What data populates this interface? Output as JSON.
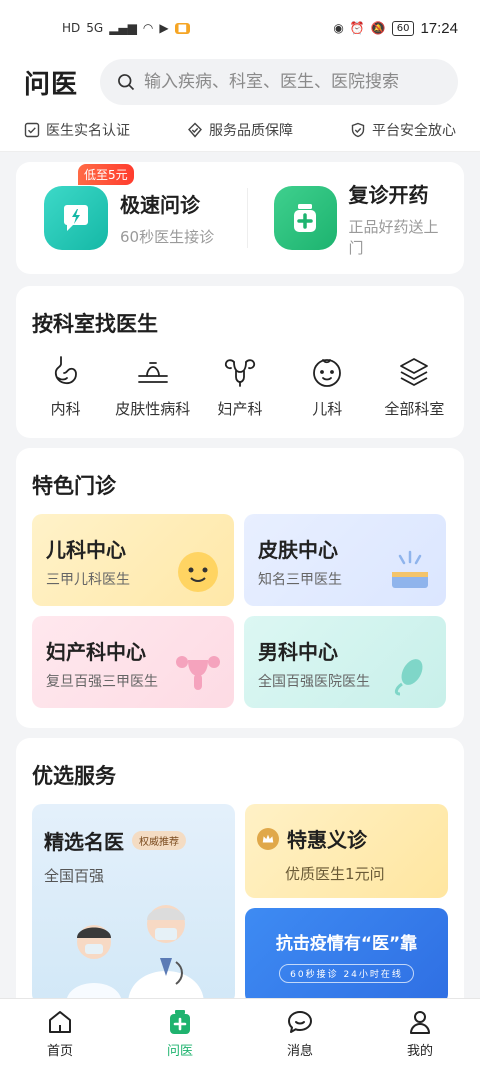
{
  "status_bar": {
    "hd": "HD",
    "network": "5G",
    "battery": "60",
    "time": "17:24"
  },
  "header": {
    "title": "问医",
    "search_placeholder": "输入疾病、科室、医生、医院搜索"
  },
  "assurances": [
    {
      "label": "医生实名认证",
      "icon": "check-square-icon"
    },
    {
      "label": "服务品质保障",
      "icon": "diamond-check-icon"
    },
    {
      "label": "平台安全放心",
      "icon": "shield-check-icon"
    }
  ],
  "quick": {
    "fast": {
      "title": "极速问诊",
      "subtitle": "60秒医生接诊",
      "badge": "低至5元",
      "icon": "chat-lightning-icon"
    },
    "revisit": {
      "title": "复诊开药",
      "subtitle": "正品好药送上门",
      "icon": "medicine-bottle-icon"
    }
  },
  "departments": {
    "title": "按科室找医生",
    "items": [
      {
        "label": "内科",
        "icon": "stomach-icon"
      },
      {
        "label": "皮肤性病科",
        "icon": "skin-icon"
      },
      {
        "label": "妇产科",
        "icon": "uterus-icon"
      },
      {
        "label": "儿科",
        "icon": "baby-face-icon"
      },
      {
        "label": "全部科室",
        "icon": "layers-icon"
      }
    ]
  },
  "special_clinics": {
    "title": "特色门诊",
    "items": [
      {
        "title": "儿科中心",
        "subtitle": "三甲儿科医生",
        "icon": "baby-face-icon"
      },
      {
        "title": "皮肤中心",
        "subtitle": "知名三甲医生",
        "icon": "skin-lamp-icon"
      },
      {
        "title": "妇产科中心",
        "subtitle": "复旦百强三甲医生",
        "icon": "uterus-icon"
      },
      {
        "title": "男科中心",
        "subtitle": "全国百强医院医生",
        "icon": "male-organ-icon"
      }
    ]
  },
  "preferred": {
    "title": "优选服务",
    "famous": {
      "title": "精选名医",
      "badge": "权威推荐",
      "subtitle": "全国百强"
    },
    "discount": {
      "title": "特惠义诊",
      "subtitle": "优质医生1元问"
    },
    "banner": {
      "title": "抗击疫情有“医”靠",
      "pill": "60秒接诊 24小时在线"
    }
  },
  "tabbar": [
    {
      "label": "首页",
      "icon": "home-icon",
      "active": false
    },
    {
      "label": "问医",
      "icon": "medical-kit-icon",
      "active": true
    },
    {
      "label": "消息",
      "icon": "message-icon",
      "active": false
    },
    {
      "label": "我的",
      "icon": "person-icon",
      "active": false
    }
  ],
  "colors": {
    "accent": "#1fb36f",
    "teal": "#15b8a6",
    "promo": "#ff3d2e"
  }
}
